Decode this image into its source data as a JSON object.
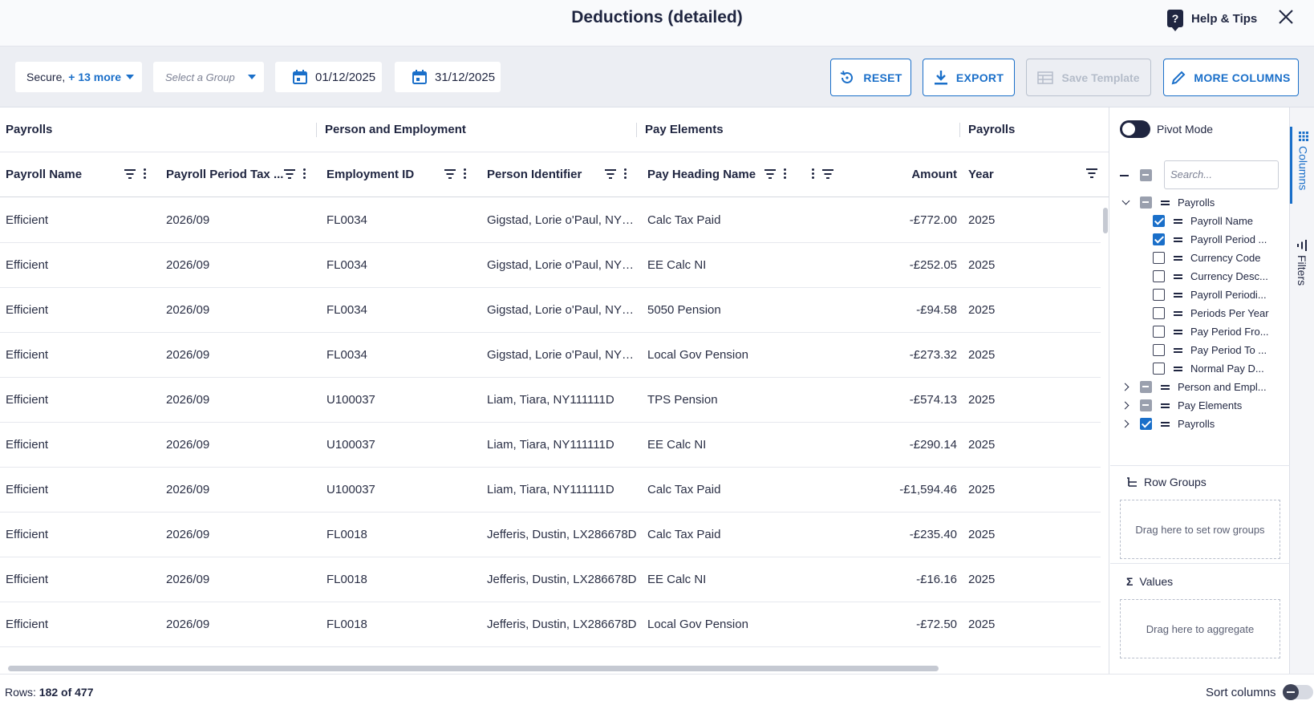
{
  "header": {
    "title": "Deductions (detailed)",
    "help_label": "Help & Tips"
  },
  "toolbar": {
    "entity_select": {
      "value": "Secure,",
      "more": "+ 13 more"
    },
    "group_select": {
      "placeholder": "Select a Group"
    },
    "date_from": "01/12/2025",
    "date_to": "31/12/2025",
    "reset_label": "RESET",
    "export_label": "EXPORT",
    "save_template_label": "Save Template",
    "more_columns_label": "MORE COLUMNS"
  },
  "grid": {
    "column_groups": [
      "Payrolls",
      "Person and Employment",
      "Pay Elements",
      "Payrolls"
    ],
    "columns": [
      "Payroll Name",
      "Payroll Period Tax ...",
      "Employment ID",
      "Person Identifier",
      "Pay Heading Name",
      "Amount",
      "Year"
    ],
    "rows": [
      [
        "Efficient",
        "2026/09",
        "FL0034",
        "Gigstad, Lorie o'Paul, NY1...",
        "Calc Tax Paid",
        "-£772.00",
        "2025"
      ],
      [
        "Efficient",
        "2026/09",
        "FL0034",
        "Gigstad, Lorie o'Paul, NY1...",
        "EE Calc NI",
        "-£252.05",
        "2025"
      ],
      [
        "Efficient",
        "2026/09",
        "FL0034",
        "Gigstad, Lorie o'Paul, NY1...",
        "5050 Pension",
        "-£94.58",
        "2025"
      ],
      [
        "Efficient",
        "2026/09",
        "FL0034",
        "Gigstad, Lorie o'Paul, NY1...",
        "Local Gov Pension",
        "-£273.32",
        "2025"
      ],
      [
        "Efficient",
        "2026/09",
        "U100037",
        "Liam, Tiara, NY111111D",
        "TPS Pension",
        "-£574.13",
        "2025"
      ],
      [
        "Efficient",
        "2026/09",
        "U100037",
        "Liam, Tiara, NY111111D",
        "EE Calc NI",
        "-£290.14",
        "2025"
      ],
      [
        "Efficient",
        "2026/09",
        "U100037",
        "Liam, Tiara, NY111111D",
        "Calc Tax Paid",
        "-£1,594.46",
        "2025"
      ],
      [
        "Efficient",
        "2026/09",
        "FL0018",
        "Jefferis, Dustin, LX286678D",
        "Calc Tax Paid",
        "-£235.40",
        "2025"
      ],
      [
        "Efficient",
        "2026/09",
        "FL0018",
        "Jefferis, Dustin, LX286678D",
        "EE Calc NI",
        "-£16.16",
        "2025"
      ],
      [
        "Efficient",
        "2026/09",
        "FL0018",
        "Jefferis, Dustin, LX286678D",
        "Local Gov Pension",
        "-£72.50",
        "2025"
      ]
    ]
  },
  "panel": {
    "pivot_label": "Pivot Mode",
    "search_placeholder": "Search...",
    "tree": [
      {
        "label": "Payrolls",
        "checked": "indeterminate",
        "expanded": true
      },
      {
        "label": "Payroll Name",
        "checked": true
      },
      {
        "label": "Payroll Period ...",
        "checked": true
      },
      {
        "label": "Currency Code",
        "checked": false
      },
      {
        "label": "Currency Desc...",
        "checked": false
      },
      {
        "label": "Payroll Periodi...",
        "checked": false
      },
      {
        "label": "Periods Per Year",
        "checked": false
      },
      {
        "label": "Pay Period Fro...",
        "checked": false
      },
      {
        "label": "Pay Period To ...",
        "checked": false
      },
      {
        "label": "Normal Pay D...",
        "checked": false
      },
      {
        "label": "Person and Empl...",
        "checked": "indeterminate",
        "expanded": false
      },
      {
        "label": "Pay Elements",
        "checked": "indeterminate",
        "expanded": false
      },
      {
        "label": "Payrolls",
        "checked": true,
        "expanded": false
      }
    ],
    "row_groups_label": "Row Groups",
    "row_groups_drop": "Drag here to set row groups",
    "values_label": "Values",
    "values_drop": "Drag here to aggregate"
  },
  "sidetabs": {
    "columns": "Columns",
    "filters": "Filters"
  },
  "footer": {
    "rows_prefix": "Rows:",
    "rows_count": "182 of 477",
    "sort_columns_label": "Sort columns"
  },
  "colors": {
    "accent": "#1a6fc9",
    "dark": "#1f2540",
    "disabled": "#b4bcc9"
  },
  "icons": {
    "help": "help-icon",
    "close": "close-icon",
    "calendar": "calendar-icon",
    "reset": "reset-icon",
    "export": "download-icon",
    "save": "table-icon",
    "more": "pencil-icon",
    "filter": "filter-icon",
    "menu": "kebab-icon",
    "columns": "columns-icon",
    "filters": "filter-icon",
    "sigma": "sigma-icon",
    "row_groups": "row-groups-icon"
  }
}
